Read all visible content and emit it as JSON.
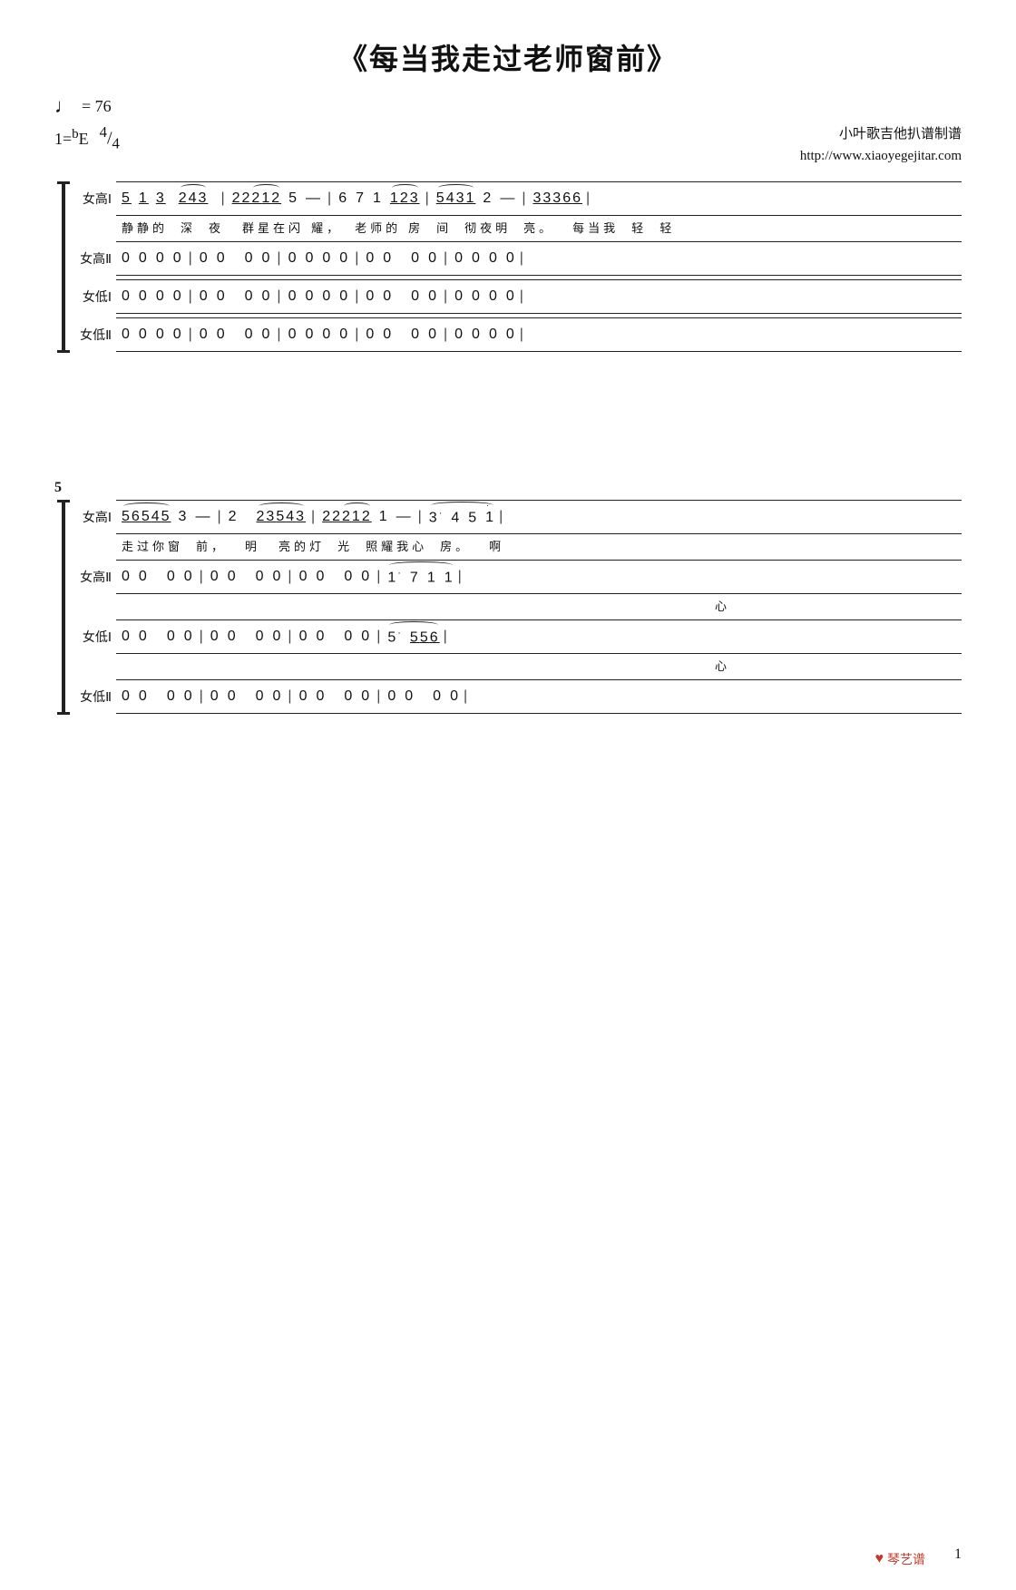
{
  "title": "《每当我走过老师窗前》",
  "tempo": "♩ = 76",
  "key": "1=ᵇE",
  "time": "4/4",
  "attribution": {
    "line1": "小叶歌吉他扒谱制谱",
    "line2": "http://www.xiaoyegejitar.com"
  },
  "section1": {
    "voices": [
      {
        "label": "女高Ⅰ",
        "music": "5̲ 1̲ 3̲  2̲4̲3̲  | 2̲2̲2̲1̲2̲  5 — | 6 7 1  1̲2̲3̲ | 5̲4̲3̲1̲  2 — | 3̲3̲3̲6̲6̲ |",
        "lyrics": "静静的 深  夜  群星在闪  耀，  老师的 房  间  彻夜明  亮。  每当我 轻  轻"
      },
      {
        "label": "女高Ⅱ",
        "music": "0 0 0 0 | 0 0  0 0 | 0 0 0 0 | 0 0  0 0 | 0 0 0 0 |",
        "lyrics": ""
      },
      {
        "label": "女低Ⅰ",
        "music": "0 0 0 0 | 0 0  0 0 | 0 0 0 0 | 0 0  0 0 | 0 0 0 0 |",
        "lyrics": ""
      },
      {
        "label": "女低Ⅱ",
        "music": "0 0 0 0 | 0 0  0 0 | 0 0 0 0 | 0 0  0 0 | 0 0 0 0 |",
        "lyrics": ""
      }
    ]
  },
  "section2": {
    "measure_start": 5,
    "voices": [
      {
        "label": "女高Ⅰ",
        "music": "5̲6̲5̲4̲5̲  3 —  | 2  2̲3̲5̲4̲3̲ | 2̲2̲2̲1̲2̲  1 — | 3·  4 5 i̇ |",
        "lyrics": "走过你窗  前，  明  亮的灯  光  照耀我心  房。  啊"
      },
      {
        "label": "女高Ⅱ",
        "music": "0 0  0 0 | 0 0  0 0 | 0 0  0 0 | 1·  7 1 1 |",
        "sub_lyrics": "心"
      },
      {
        "label": "女低Ⅰ",
        "music": "0 0  0 0 | 0 0  0 0 | 0 0  0 0 | 5·  5̲5̲6̲ |",
        "sub_lyrics": "心"
      },
      {
        "label": "女低Ⅱ",
        "music": "0 0  0 0 | 0 0  0 0 | 0 0  0 0 | 0 0  0 0 |",
        "lyrics": ""
      }
    ]
  },
  "page_number": "1",
  "watermark": "琴艺谱"
}
